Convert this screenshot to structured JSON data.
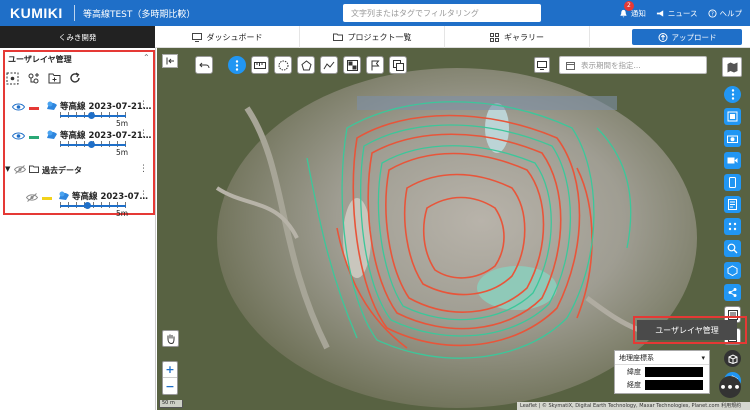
{
  "header": {
    "logo": "KUMIKI",
    "project": "等高線TEST（多時期比較）",
    "search_placeholder": "文字列またはタグでフィルタリング",
    "notify_label": "通知",
    "notify_count": "2",
    "news_label": "ニュース",
    "help_label": "ヘルプ"
  },
  "nav": {
    "site": "くみき開発",
    "tabs": [
      {
        "label": "ダッシュボード"
      },
      {
        "label": "プロジェクト一覧"
      },
      {
        "label": "ギャラリー"
      }
    ],
    "upload_label": "アップロード"
  },
  "panel": {
    "title": "ユーザレイヤ管理",
    "layers": [
      {
        "name": "等高線 2023-07-21…",
        "color": "#e53935",
        "value": "5m",
        "visible": true
      },
      {
        "name": "等高線 2023-07-21…",
        "color": "#2aa876",
        "value": "5m",
        "visible": true
      }
    ],
    "folder": {
      "name": "過去データ"
    },
    "folder_layer": {
      "name": "等高線 2023-07…",
      "color": "#f2d21b",
      "value": "5m",
      "visible": false
    }
  },
  "map": {
    "period_placeholder": "表示期間を指定...",
    "userlayer_tip": "ユーザレイヤ管理",
    "coord_system": "地理座標系",
    "lat_label": "緯度",
    "lng_label": "経度",
    "scale_label": "50 m",
    "attribution": "Leaflet | © SkymatiX, Digital Earth Technology, Maxar Technologies, Planet.com 利用規約"
  },
  "colors": {
    "brand": "#1f6fc8",
    "accent": "#2196f3",
    "highlight": "#e53935",
    "contour_red": "#e8553a",
    "contour_green": "#3cc79a"
  }
}
